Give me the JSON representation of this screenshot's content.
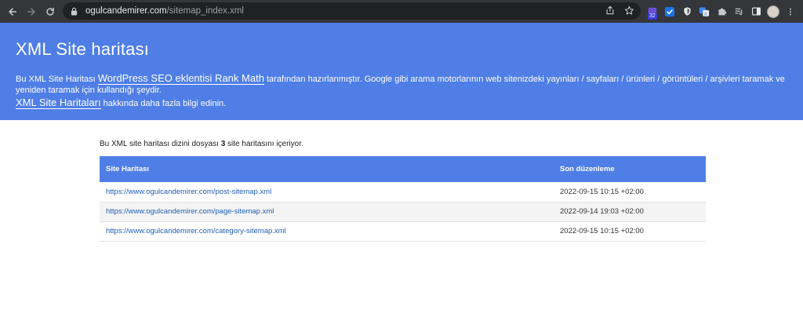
{
  "browser": {
    "url_domain": "ogulcandemirer.com",
    "url_path": "/sitemap_index.xml",
    "extension_badge": "32",
    "icons": [
      "back-icon",
      "forward-icon",
      "reload-icon",
      "lock-icon",
      "share-icon",
      "star-icon"
    ]
  },
  "header": {
    "title": "XML Site haritası",
    "desc_before": "Bu XML Site Haritası ",
    "desc_link": "WordPress SEO eklentisi Rank Math",
    "desc_after": " tarafından hazırlanmıştır. Google gibi arama motorlarının web sitenizdeki yayınları / sayfaları / ürünleri / görüntüleri / arşivleri taramak ve yeniden taramak için kullandığı şeydir.",
    "more_link": "XML Site Haritaları",
    "more_after": " hakkında daha fazla bilgi edinin."
  },
  "intro": {
    "before": "Bu XML site haritası dizini dosyası ",
    "count": "3",
    "after": " site haritasını içeriyor."
  },
  "table": {
    "headers": [
      "Site Haritası",
      "Son düzenleme"
    ],
    "rows": [
      {
        "url": "https://www.ogulcandemirer.com/post-sitemap.xml",
        "date": "2022-09-15 10:15 +02:00"
      },
      {
        "url": "https://www.ogulcandemirer.com/page-sitemap.xml",
        "date": "2022-09-14 19:03 +02:00"
      },
      {
        "url": "https://www.ogulcandemirer.com/category-sitemap.xml",
        "date": "2022-09-15 10:15 +02:00"
      }
    ]
  },
  "colors": {
    "accent": "#4f7ee6",
    "link": "#1f5fb8",
    "chrome": "#35363a"
  }
}
